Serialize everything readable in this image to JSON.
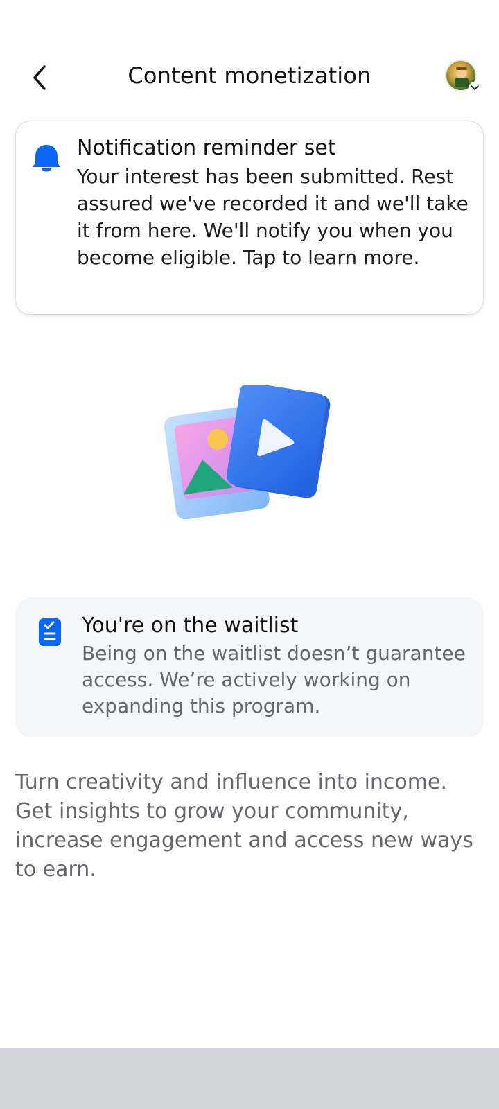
{
  "header": {
    "title": "Content monetization",
    "back_icon": "chevron-left-icon",
    "avatar_icon": "profile-avatar"
  },
  "notification": {
    "icon": "bell-icon",
    "title": "Notification reminder set",
    "body": "Your interest has been submitted. Rest assured we've recorded it and we'll take it from here. We'll notify you when you become eligible. Tap to learn more."
  },
  "illustration": {
    "icon": "photo-video-illustration"
  },
  "waitlist": {
    "icon": "clipboard-check-icon",
    "title": "You're on the waitlist",
    "body": "Being on the waitlist doesn’t guarantee access. We’re actively working on expanding this program."
  },
  "description": "Turn creativity and influence into income. Get insights to grow your community, increase engagement and access new ways to earn.",
  "colors": {
    "accent": "#0a66f5",
    "card_bg": "#f5f6f7",
    "secondary_text": "#65676b",
    "bottom_bar": "#d4d5d9"
  }
}
